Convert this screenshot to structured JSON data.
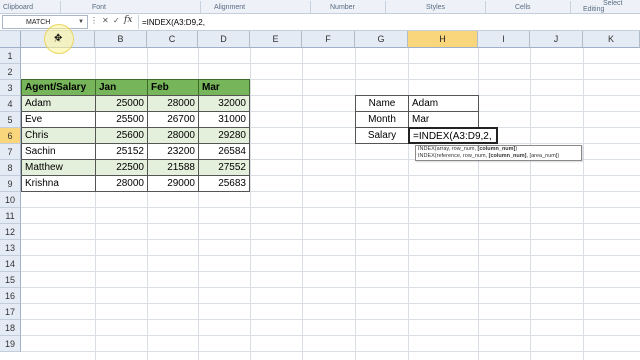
{
  "ribbon": {
    "groups": [
      "Clipboard",
      "Font",
      "Alignment",
      "Number",
      "Styles",
      "Cells",
      "Editing"
    ],
    "editing_item": "Select"
  },
  "formula_bar": {
    "name_box": "MATCH",
    "fx_label": "fx",
    "formula": "=INDEX(A3:D9,2,"
  },
  "columns": [
    "A",
    "B",
    "C",
    "D",
    "E",
    "F",
    "G",
    "H",
    "I",
    "J",
    "K"
  ],
  "rows": [
    "1",
    "2",
    "3",
    "4",
    "5",
    "6",
    "7",
    "8",
    "9",
    "10",
    "11",
    "12",
    "13",
    "14",
    "15",
    "16",
    "17",
    "18",
    "19"
  ],
  "selected": {
    "column": "H",
    "row": "6"
  },
  "table": {
    "headers": [
      "Agent/Salary",
      "Jan",
      "Feb",
      "Mar"
    ],
    "rows": [
      [
        "Adam",
        "25000",
        "28000",
        "32000"
      ],
      [
        "Eve",
        "25500",
        "26700",
        "31000"
      ],
      [
        "Chris",
        "25600",
        "28000",
        "29280"
      ],
      [
        "Sachin",
        "25152",
        "23200",
        "26584"
      ],
      [
        "Matthew",
        "22500",
        "21588",
        "27552"
      ],
      [
        "Krishna",
        "28000",
        "29000",
        "25683"
      ]
    ]
  },
  "lookup": {
    "labels": [
      "Name",
      "Month",
      "Salary"
    ],
    "values": [
      "Adam",
      "Mar",
      "=INDEX(A3:D9,2,"
    ]
  },
  "tooltip": {
    "line1_pre": "INDEX(array, row_num, ",
    "line1_bold": "[column_num]",
    "line1_post": ")",
    "line2_pre": "INDEX(reference, row_num, ",
    "line2_bold": "[column_num]",
    "line2_post": ", [area_num])"
  },
  "colors": {
    "header_fill": "#77b55a",
    "band_fill": "#e4efdc",
    "selected_header": "#f9d67b"
  }
}
